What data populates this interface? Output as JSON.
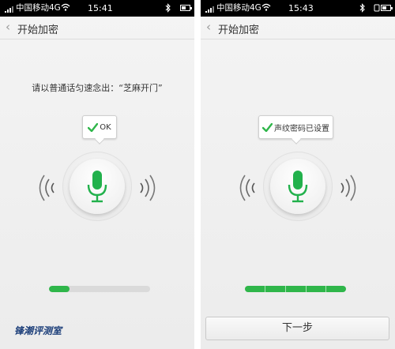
{
  "screens": [
    {
      "status": {
        "carrier": "中国移动4G",
        "time": "15:41"
      },
      "title": "开始加密",
      "prompt": "请以普通话匀速念出：“芝麻开门”",
      "bubble": "OK",
      "progress_fraction": 0.2,
      "watermark": {
        "text": "锋潮评测室",
        "subtext": ""
      }
    },
    {
      "status": {
        "carrier": "中国移动4G",
        "time": "15:43"
      },
      "title": "开始加密",
      "bubble": "声纹密码已设置",
      "progress_fraction": 1.0,
      "next_button": "下一步"
    }
  ],
  "colors": {
    "accent": "#2fb64a",
    "text": "#333333"
  },
  "icons": [
    "signal-icon",
    "wifi-icon",
    "bluetooth-icon",
    "battery-icon",
    "back-chevron-icon",
    "check-icon",
    "microphone-icon",
    "sound-wave-icon"
  ]
}
